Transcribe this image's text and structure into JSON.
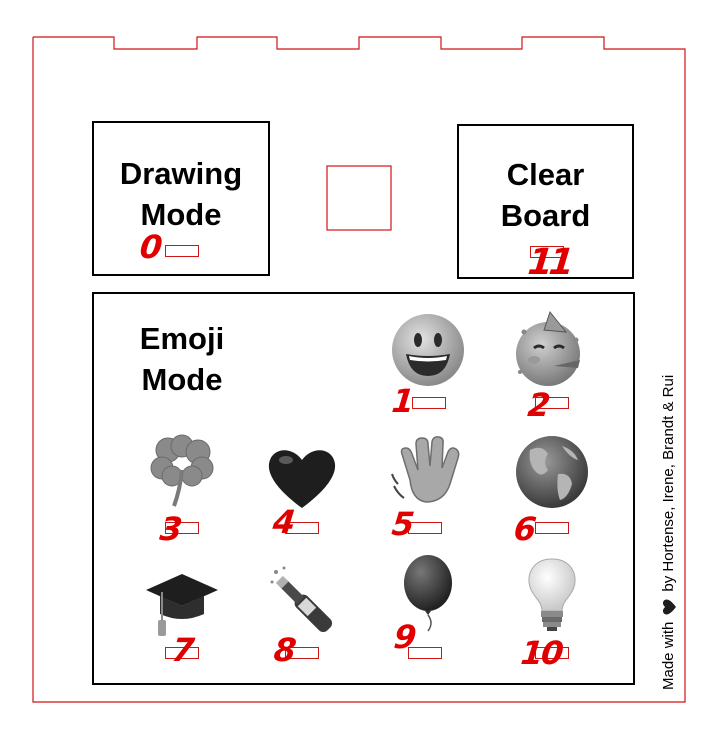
{
  "boxes": {
    "drawing_mode": {
      "line1": "Drawing",
      "line2": "Mode"
    },
    "clear_board": {
      "line1": "Clear",
      "line2": "Board"
    },
    "emoji_mode": {
      "line1": "Emoji",
      "line2": "Mode"
    }
  },
  "numbers": {
    "drawing": "0",
    "clear": "11",
    "e1": "1",
    "e2": "2",
    "e3": "3",
    "e4": "4",
    "e5": "5",
    "e6": "6",
    "e7": "7",
    "e8": "8",
    "e9": "9",
    "e10": "10"
  },
  "emojis": [
    "grinning-face",
    "partying-face",
    "shamrock",
    "black-heart",
    "waving-hand",
    "globe",
    "graduation-cap",
    "champagne-bottle",
    "balloon",
    "light-bulb"
  ],
  "credit": {
    "before": "Made with",
    "after": "by Hortense, Irene, Brandt & Rui"
  },
  "colors": {
    "cut_line": "#d01515",
    "handwriting": "#e00000",
    "ink": "#000000"
  }
}
